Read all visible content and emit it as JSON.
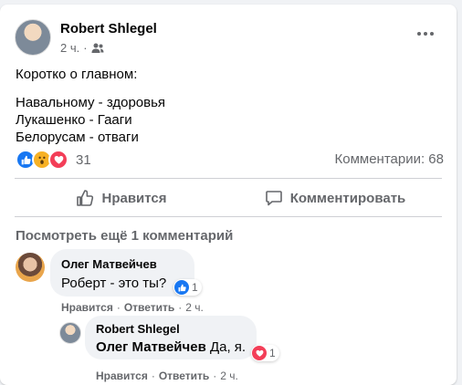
{
  "post": {
    "author": "Robert Shlegel",
    "time": "2 ч.",
    "separator": "·",
    "text_lines": [
      "Коротко о главном:",
      "",
      "Навальному - здоровья",
      "Лукашенко - Гааги",
      "Белорусам - отваги"
    ],
    "reaction_count": "31",
    "comments_label": "Комментарии: 68",
    "reactions": [
      "like-icon",
      "wow-icon",
      "love-icon"
    ]
  },
  "actions": {
    "like_label": "Нравится",
    "comment_label": "Комментировать"
  },
  "comments": {
    "view_more": "Посмотреть ещё 1 комментарий",
    "first": {
      "author": "Олег Матвейчев",
      "text": "Роберт - это ты?",
      "reaction_count": "1",
      "like": "Нравится",
      "reply": "Ответить",
      "time": "2 ч."
    },
    "reply": {
      "author": "Robert Shlegel",
      "mention": "Олег Матвейчев",
      "text": " Да, я.",
      "reaction_count": "1",
      "like": "Нравится",
      "reply": "Ответить",
      "time": "2 ч."
    }
  },
  "colors": {
    "like": "#1877f2",
    "wow": "#f7b125",
    "love": "#f33e58",
    "secondary_text": "#65676b"
  }
}
